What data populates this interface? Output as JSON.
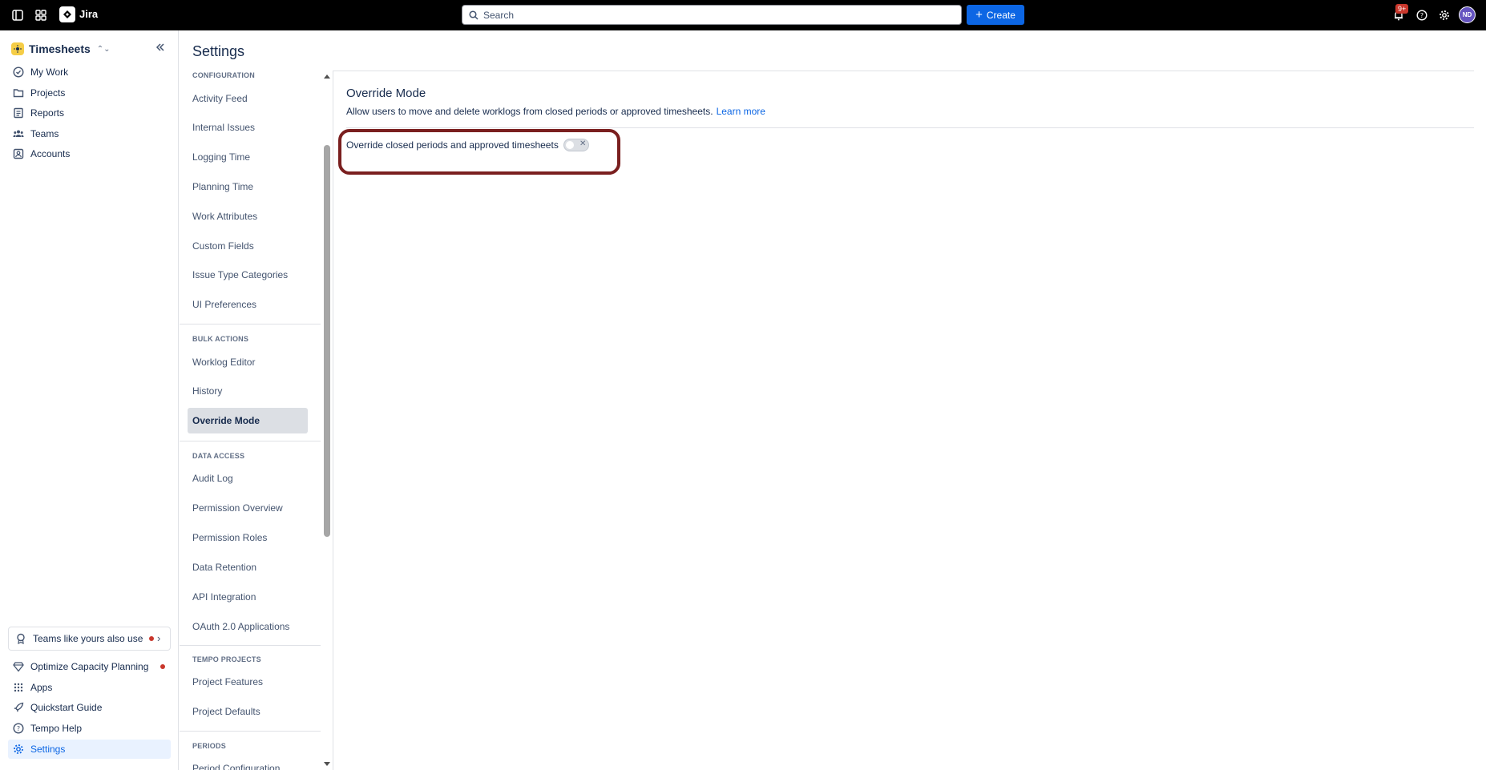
{
  "topbar": {
    "app_name": "Jira",
    "search_placeholder": "Search",
    "create_label": "Create",
    "notification_count": "9+",
    "avatar_initials": "ND"
  },
  "sidebar": {
    "product_name": "Timesheets",
    "items": [
      {
        "label": "My Work",
        "icon": "check-circle-icon"
      },
      {
        "label": "Projects",
        "icon": "folder-icon"
      },
      {
        "label": "Reports",
        "icon": "report-icon"
      },
      {
        "label": "Teams",
        "icon": "people-icon"
      },
      {
        "label": "Accounts",
        "icon": "account-icon"
      }
    ],
    "promo_label": "Teams like yours also use",
    "bottom_items": [
      {
        "label": "Optimize Capacity Planning",
        "icon": "diamond-icon"
      },
      {
        "label": "Apps",
        "icon": "apps-grid-icon"
      },
      {
        "label": "Quickstart Guide",
        "icon": "rocket-icon"
      },
      {
        "label": "Tempo Help",
        "icon": "help-icon"
      },
      {
        "label": "Settings",
        "icon": "gear-icon"
      }
    ]
  },
  "page": {
    "title": "Settings"
  },
  "settings_nav": {
    "sections": [
      {
        "title": "CONFIGURATION",
        "items": [
          "Activity Feed",
          "Internal Issues",
          "Logging Time",
          "Planning Time",
          "Work Attributes",
          "Custom Fields",
          "Issue Type Categories",
          "UI Preferences"
        ]
      },
      {
        "title": "BULK ACTIONS",
        "items": [
          "Worklog Editor",
          "History",
          "Override Mode"
        ]
      },
      {
        "title": "DATA ACCESS",
        "items": [
          "Audit Log",
          "Permission Overview",
          "Permission Roles",
          "Data Retention",
          "API Integration",
          "OAuth 2.0 Applications"
        ]
      },
      {
        "title": "TEMPO PROJECTS",
        "items": [
          "Project Features",
          "Project Defaults"
        ]
      },
      {
        "title": "PERIODS",
        "items": [
          "Period Configuration"
        ]
      }
    ],
    "selected": "Override Mode"
  },
  "content": {
    "section_title": "Override Mode",
    "description": "Allow users to move and delete worklogs from closed periods or approved timesheets.",
    "learn_more": "Learn more",
    "setting_label": "Override closed periods and approved timesheets",
    "toggle_enabled": false,
    "toggle_off_glyph": "✕"
  },
  "colors": {
    "accent": "#0c66e4",
    "highlight_ring": "#7a1f1f",
    "topbar": "#000000"
  }
}
